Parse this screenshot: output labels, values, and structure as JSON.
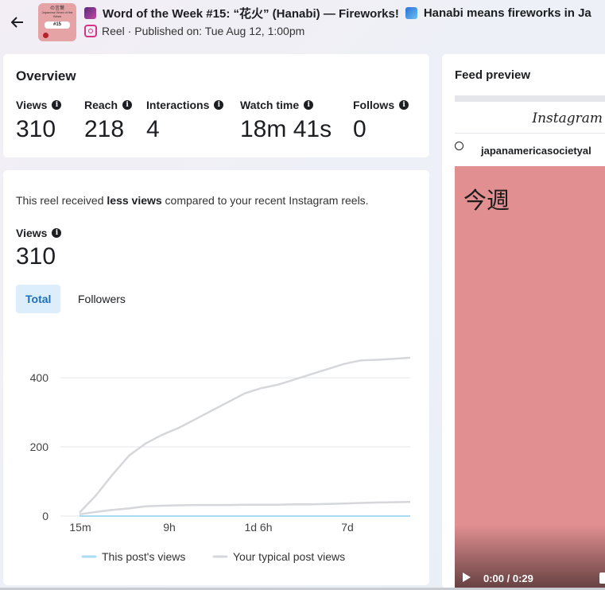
{
  "header": {
    "back_label": "←",
    "thumbnail": {
      "top_text": "の言葉",
      "sub_text": "Japanese Word of the Week",
      "badge": "#15"
    },
    "title": "Word of the Week #15: “花火” (Hanabi) — Fireworks!",
    "title_tail": "Hanabi means fireworks in Ja",
    "subtitle": "Reel · Published on: Tue Aug 12, 1:00pm"
  },
  "overview": {
    "title": "Overview",
    "metrics": [
      {
        "label": "Views",
        "value": "310"
      },
      {
        "label": "Reach",
        "value": "218"
      },
      {
        "label": "Interactions",
        "value": "4"
      },
      {
        "label": "Watch time",
        "value": "18m 41s"
      },
      {
        "label": "Follows",
        "value": "0"
      }
    ]
  },
  "detail": {
    "note_pre": "This reel received ",
    "note_bold": "less views",
    "note_post": " compared to your recent Instagram reels.",
    "views_label": "Views",
    "views_value": "310",
    "tabs": [
      "Total",
      "Followers"
    ]
  },
  "chart_data": {
    "type": "line",
    "x_ticks": [
      "15m",
      "9h",
      "1d 6h",
      "7d"
    ],
    "y_ticks": [
      0,
      200,
      400
    ],
    "ylim": [
      0,
      460
    ],
    "grid": true,
    "legend_position": "bottom",
    "series": [
      {
        "name": "This post's views",
        "color": "#a8dcf4",
        "values": [
          0,
          0,
          0,
          0,
          0,
          0,
          0,
          0,
          0,
          0,
          0,
          0,
          0,
          0,
          0,
          0,
          0,
          0,
          0,
          0,
          0
        ]
      },
      {
        "name": "Your typical post views",
        "color": "#d5d7da",
        "values": [
          5,
          12,
          18,
          22,
          28,
          30,
          31,
          32,
          32,
          32,
          33,
          33,
          33,
          34,
          34,
          35,
          36,
          38,
          39,
          40,
          41
        ]
      },
      {
        "name": "Your typical post views",
        "color": "#d5d7da",
        "values": [
          10,
          60,
          120,
          175,
          210,
          235,
          255,
          280,
          305,
          330,
          355,
          370,
          380,
          395,
          410,
          425,
          440,
          450,
          452,
          455,
          458
        ]
      }
    ]
  },
  "feed": {
    "title": "Feed preview",
    "logo": "Instagram",
    "username": "japanamericasocietyal",
    "video_text": "今週",
    "time": "0:00 / 0:29"
  }
}
